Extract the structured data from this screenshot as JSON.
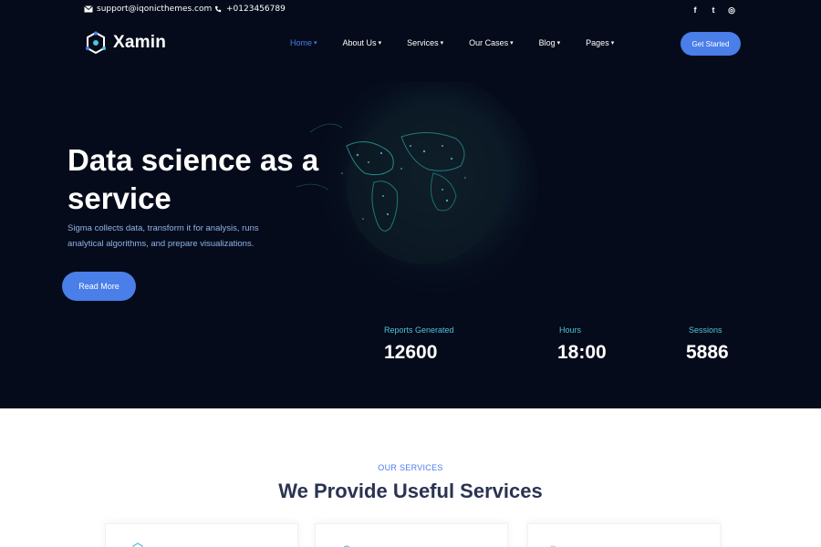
{
  "topbar": {
    "email": "support@iqonicthemes.com",
    "phone": "+0123456789",
    "socials": [
      {
        "name": "facebook-icon",
        "glyph": "f"
      },
      {
        "name": "twitter-icon",
        "glyph": "t"
      },
      {
        "name": "instagram-icon",
        "glyph": "◎"
      }
    ]
  },
  "brand": {
    "name": "Xamin"
  },
  "nav": {
    "items": [
      {
        "label": "Home",
        "active": true
      },
      {
        "label": "About Us",
        "active": false
      },
      {
        "label": "Services",
        "active": false
      },
      {
        "label": "Our Cases",
        "active": false
      },
      {
        "label": "Blog",
        "active": false
      },
      {
        "label": "Pages",
        "active": false
      }
    ],
    "cta_label": "Get Started"
  },
  "hero": {
    "title": "Data science as a service",
    "subtitle": "Sigma collects data, transform it for analysis, runs analytical algorithms, and prepare visualizations.",
    "button_label": "Read More"
  },
  "stats": [
    {
      "label": "Reports Generated",
      "value": "12600"
    },
    {
      "label": "Hours",
      "value": "18:00"
    },
    {
      "label": "Sessions",
      "value": "5886"
    }
  ],
  "services": {
    "eyebrow": "OUR SERVICES",
    "title": "We Provide Useful Services"
  },
  "colors": {
    "hero_bg": "#050b1a",
    "accent": "#4a7ee8",
    "stat_label": "#4fc3dc",
    "heading_dark": "#2a3352"
  }
}
